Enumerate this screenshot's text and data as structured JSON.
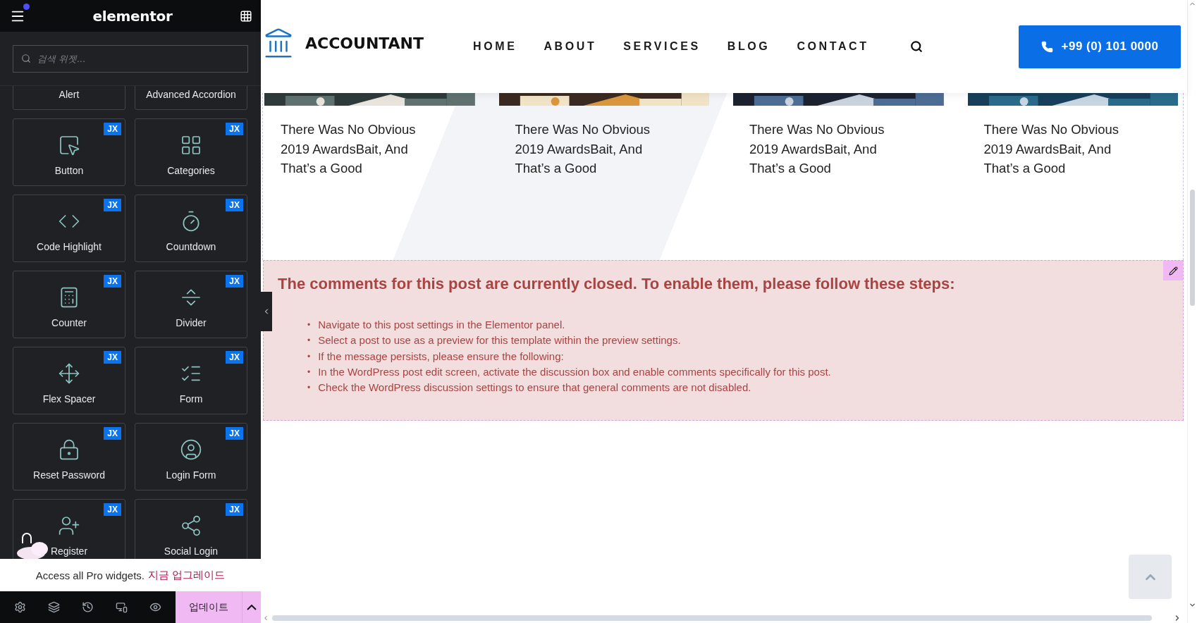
{
  "panel": {
    "title": "elementor",
    "search": {
      "placeholder": "검색 위젯..."
    },
    "widgets": [
      {
        "label": "Alert"
      },
      {
        "label": "Advanced Accordion"
      },
      {
        "label": "Button",
        "badge": "JX"
      },
      {
        "label": "Categories",
        "badge": "JX"
      },
      {
        "label": "Code Highlight",
        "badge": "JX"
      },
      {
        "label": "Countdown",
        "badge": "JX"
      },
      {
        "label": "Counter",
        "badge": "JX"
      },
      {
        "label": "Divider",
        "badge": "JX"
      },
      {
        "label": "Flex Spacer",
        "badge": "JX"
      },
      {
        "label": "Form",
        "badge": "JX"
      },
      {
        "label": "Reset Password",
        "badge": "JX"
      },
      {
        "label": "Login Form",
        "badge": "JX"
      },
      {
        "label": "Register",
        "badge": "JX"
      },
      {
        "label": "Social Login",
        "badge": "JX"
      }
    ],
    "promo": {
      "text": "Access all Pro widgets.",
      "link": "지금 업그레이드"
    },
    "footer": {
      "update_button": "업데이트"
    }
  },
  "site": {
    "logo": "ACCOUNTANT",
    "nav": [
      "HOME",
      "ABOUT",
      "SERVICES",
      "BLOG",
      "CONTACT"
    ],
    "phone": "+99 (0) 101 0000"
  },
  "posts": [
    {
      "title": "There Was No Obvious 2019 AwardsBait, And That’s a Good"
    },
    {
      "title": "There Was No Obvious 2019 AwardsBait, And That’s a Good"
    },
    {
      "title": "There Was No Obvious 2019 AwardsBait, And That’s a Good"
    },
    {
      "title": "There Was No Obvious 2019 AwardsBait, And That’s a Good"
    }
  ],
  "notice": {
    "bullet": "•",
    "title": "The comments for this post are currently closed. To enable them, please follow these steps:",
    "steps": [
      "Navigate to this post settings in the Elementor panel.",
      "Select a post to use as a preview for this template within the preview settings.",
      "If the message persists, please ensure the following:",
      "In the WordPress post edit screen, activate the discussion box and enable comments specifically for this post.",
      "Check the WordPress discussion settings to ensure that general comments are not disabled."
    ]
  }
}
